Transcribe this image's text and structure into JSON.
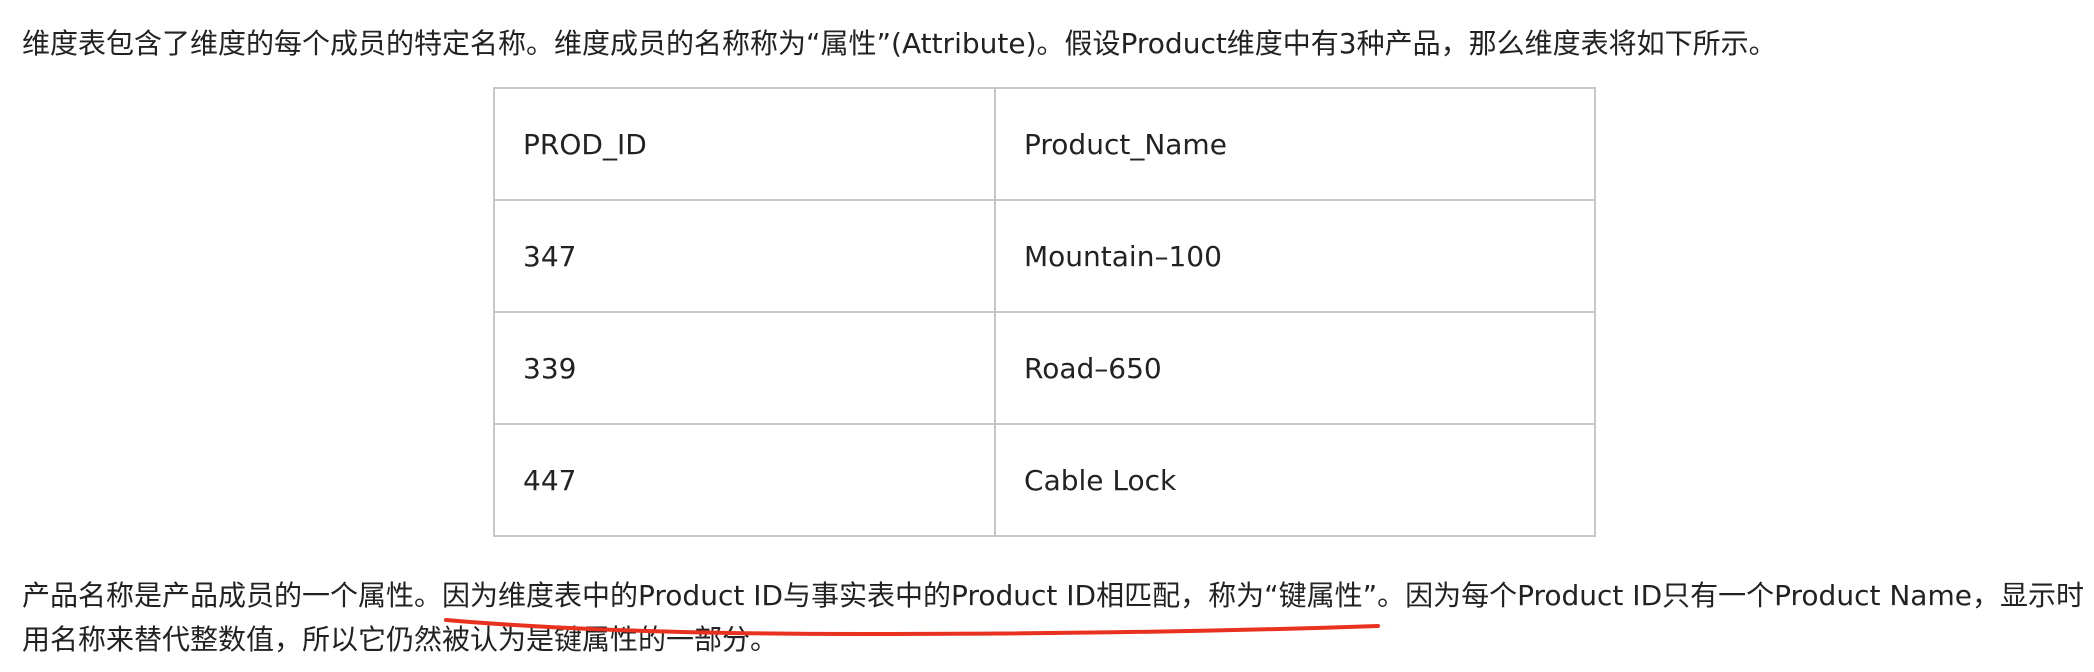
{
  "intro_paragraph": "维度表包含了维度的每个成员的特定名称。维度成员的名称称为“属性”(Attribute)。假设Product维度中有3种产品，那么维度表将如下所示。",
  "table": {
    "headers": [
      "PROD_ID",
      "Product_Name"
    ],
    "rows": [
      [
        "347",
        "Mountain–100"
      ],
      [
        "339",
        "Road–650"
      ],
      [
        "447",
        "Cable Lock"
      ]
    ]
  },
  "closing_paragraph": {
    "part_before": "产品名称是产品成员的一个属性。",
    "part_underlined": "因为维度表中的Product ID与事实表中的Product ID相匹配，称为“键属性”",
    "part_after_line1": "。因为每个Product ID只有一个Product Name，显示时",
    "line2": "用名称来替代整数值，所以它仍然被认为是键属性的一部分。"
  },
  "colors": {
    "text": "#222222",
    "table_border": "#c7c7c7",
    "annotation_underline": "#e8311f"
  }
}
